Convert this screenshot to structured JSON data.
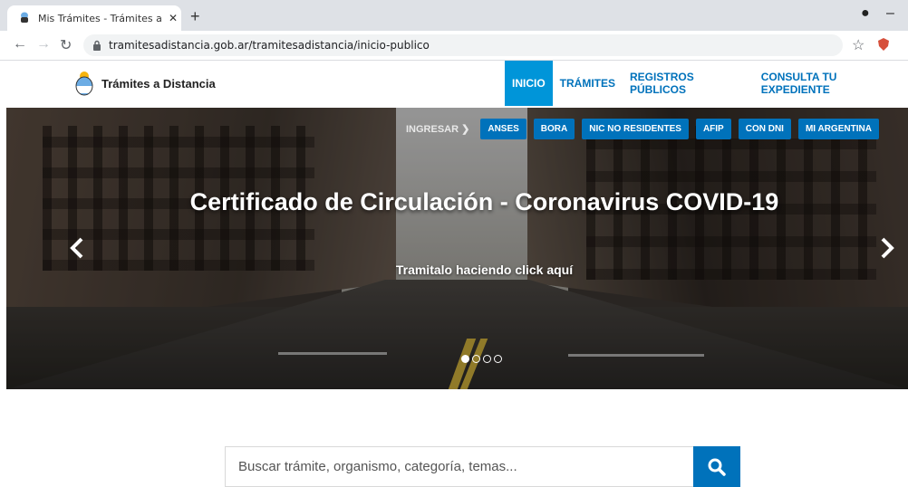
{
  "browser": {
    "tab_title": "Mis Trámites - Trámites a Distanc",
    "url": "tramitesadistancia.gob.ar/tramitesadistancia/inicio-publico",
    "icons": [
      "back-icon",
      "forward-icon",
      "reload-icon",
      "lock-icon",
      "star-icon",
      "extension-icon",
      "menu-icon",
      "new-tab-icon",
      "close-tab-icon"
    ]
  },
  "header": {
    "brand": "Trámites a Distancia",
    "nav": [
      {
        "label": "INICIO",
        "active": true
      },
      {
        "label": "TRÁMITES",
        "active": false
      },
      {
        "label": "REGISTROS PÚBLICOS",
        "active": false
      },
      {
        "label": "CONSULTA TU EXPEDIENTE",
        "active": false
      }
    ]
  },
  "quickbar": {
    "ingresar": "INGRESAR",
    "chips": [
      "ANSES",
      "BORA",
      "NIC NO RESIDENTES",
      "AFIP",
      "CON DNI",
      "MI ARGENTINA"
    ]
  },
  "hero": {
    "title": "Certificado de Circulación - Coronavirus COVID-19",
    "subtitle": "Tramitalo haciendo click aquí",
    "slides": 4,
    "active_slide": 1
  },
  "search": {
    "placeholder": "Buscar trámite, organismo, categoría, temas..."
  },
  "colors": {
    "primary": "#0072bb",
    "active_nav": "#0095d9"
  }
}
